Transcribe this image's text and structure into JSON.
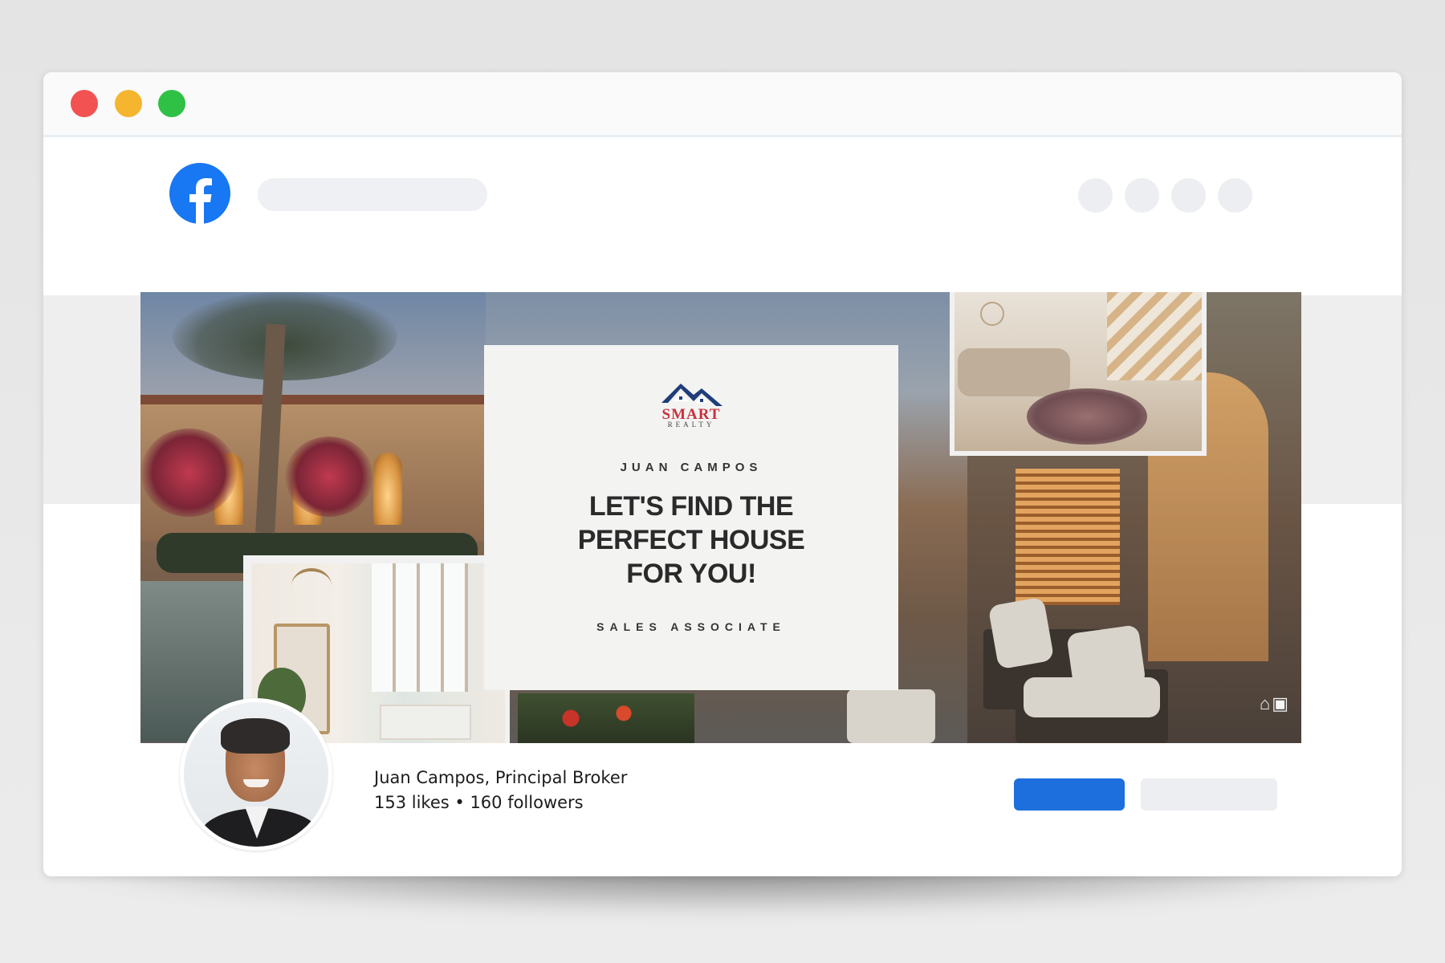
{
  "window": {
    "controls": [
      "close",
      "minimize",
      "maximize"
    ],
    "colors": {
      "close": "#f25252",
      "minimize": "#f6b52e",
      "maximize": "#2fc145"
    }
  },
  "header": {
    "logo_icon": "facebook-logo-icon",
    "brand_color": "#1877f2",
    "nav_icon_count": 4
  },
  "cover": {
    "logo_text": "SMART",
    "logo_subtext": "REALTY",
    "name": "JUAN CAMPOS",
    "headline": [
      "LET'S FIND THE",
      "PERFECT HOUSE",
      "FOR YOU!"
    ],
    "role": "SALES ASSOCIATE",
    "badges_icon": "equal-housing-realtor-icon"
  },
  "profile": {
    "name": "Juan Campos, Principal Broker",
    "stats": "153 likes • 160 followers",
    "avatar_icon": "profile-photo"
  },
  "actions": {
    "primary_color": "#1c6fdc",
    "secondary_color": "#eceef1"
  }
}
